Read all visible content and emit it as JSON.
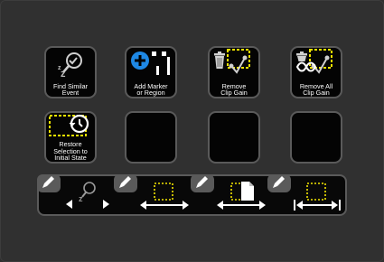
{
  "colors": {
    "background": "#303030",
    "key_border": "#5a5a5a",
    "key_fill": "#040404",
    "accent_yellow": "#f2e500",
    "accent_blue": "#1e88e5",
    "text": "#ffffff"
  },
  "buttons": [
    {
      "id": "find-similar-event",
      "label": "Find Similar\nEvent",
      "icon": "find-similar-icon"
    },
    {
      "id": "add-marker-or-region",
      "label": "Add Marker\nor Region",
      "icon": "add-marker-icon"
    },
    {
      "id": "remove-clip-gain",
      "label": "Remove\nClip Gain",
      "icon": "remove-clip-gain-icon"
    },
    {
      "id": "remove-all-clip-gain",
      "label": "Remove All\nClip Gain",
      "icon": "remove-all-clip-gain-icon"
    },
    {
      "id": "restore-selection",
      "label": "Restore\nSelection to\nInitial State",
      "icon": "restore-selection-icon"
    },
    {
      "id": "empty-key-6",
      "label": "",
      "icon": ""
    },
    {
      "id": "empty-key-7",
      "label": "",
      "icon": ""
    },
    {
      "id": "empty-key-8",
      "label": "",
      "icon": ""
    }
  ],
  "dials": [
    {
      "id": "find-similar-dial",
      "icon": "find-similar-arrows-icon"
    },
    {
      "id": "nudge-selection-dial",
      "icon": "nudge-selection-icon"
    },
    {
      "id": "nudge-clip-dial",
      "icon": "nudge-clip-icon"
    },
    {
      "id": "trim-selection-dial",
      "icon": "trim-selection-icon"
    }
  ]
}
